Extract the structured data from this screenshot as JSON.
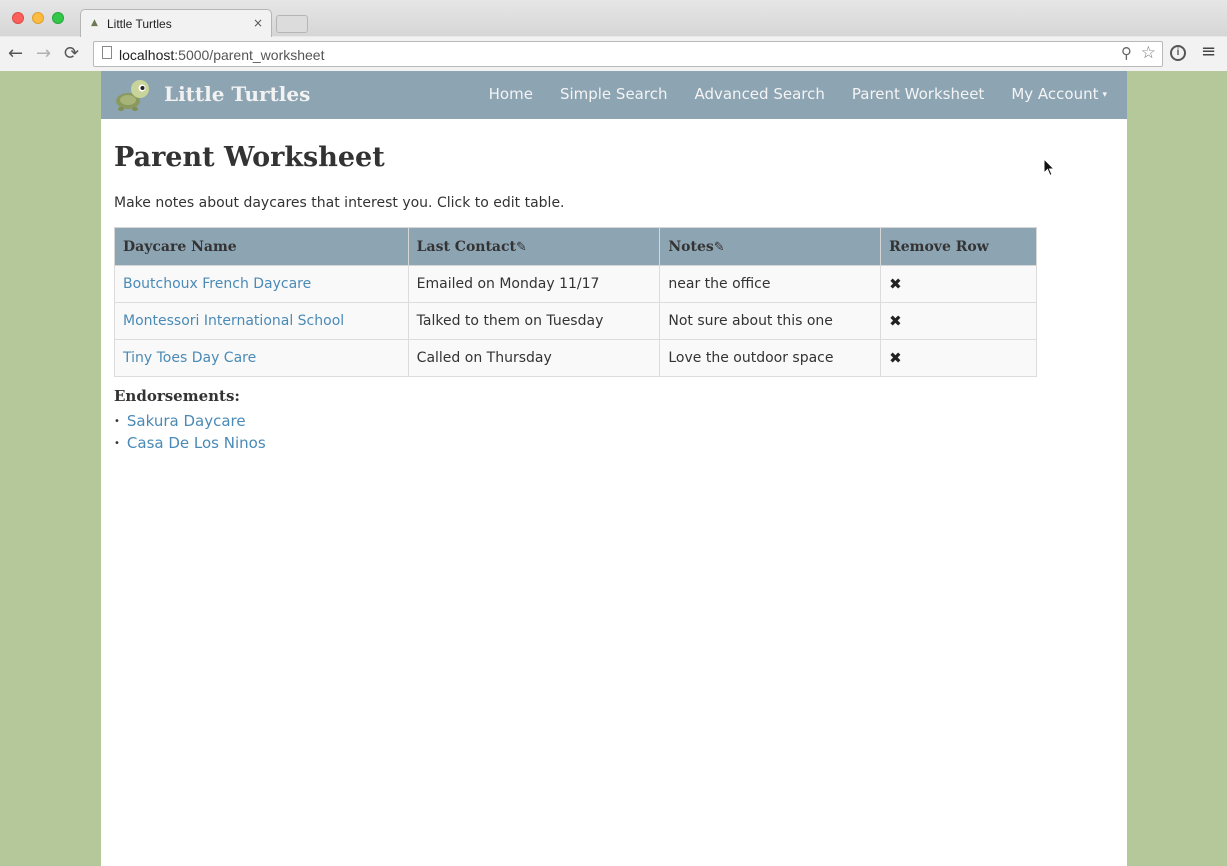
{
  "browser": {
    "tab_title": "Little Turtles",
    "tab_close": "×",
    "url_host": "localhost",
    "url_path": ":5000/parent_worksheet",
    "nav": {
      "back": "←",
      "forward": "→",
      "reload": "⟳"
    },
    "icons": {
      "zoom": "⚲",
      "star": "☆",
      "ext": "i",
      "menu": "≡"
    }
  },
  "navbar": {
    "brand": "Little Turtles",
    "links": [
      "Home",
      "Simple Search",
      "Advanced Search",
      "Parent Worksheet",
      "My Account"
    ],
    "caret": "▾"
  },
  "main": {
    "title": "Parent Worksheet",
    "intro": "Make notes about daycares that interest you. Click to edit table.",
    "table": {
      "headers": [
        "Daycare Name",
        "Last Contact",
        "Notes",
        "Remove Row"
      ],
      "edit_icon": "✎",
      "remove_icon": "✖",
      "rows": [
        {
          "name": "Boutchoux French Daycare",
          "contact": "Emailed on Monday 11/17",
          "notes": "near the office"
        },
        {
          "name": "Montessori International School",
          "contact": "Talked to them on Tuesday",
          "notes": "Not sure about this one"
        },
        {
          "name": "Tiny Toes Day Care",
          "contact": "Called on Thursday",
          "notes": "Love the outdoor space"
        }
      ]
    },
    "endorsements": {
      "title": "Endorsements:",
      "items": [
        "Sakura Daycare",
        "Casa De Los Ninos"
      ],
      "bullet": "•"
    }
  },
  "colors": {
    "navbar": "#8da4b3",
    "link": "#4a8ab6",
    "background": "#b5c89a"
  }
}
